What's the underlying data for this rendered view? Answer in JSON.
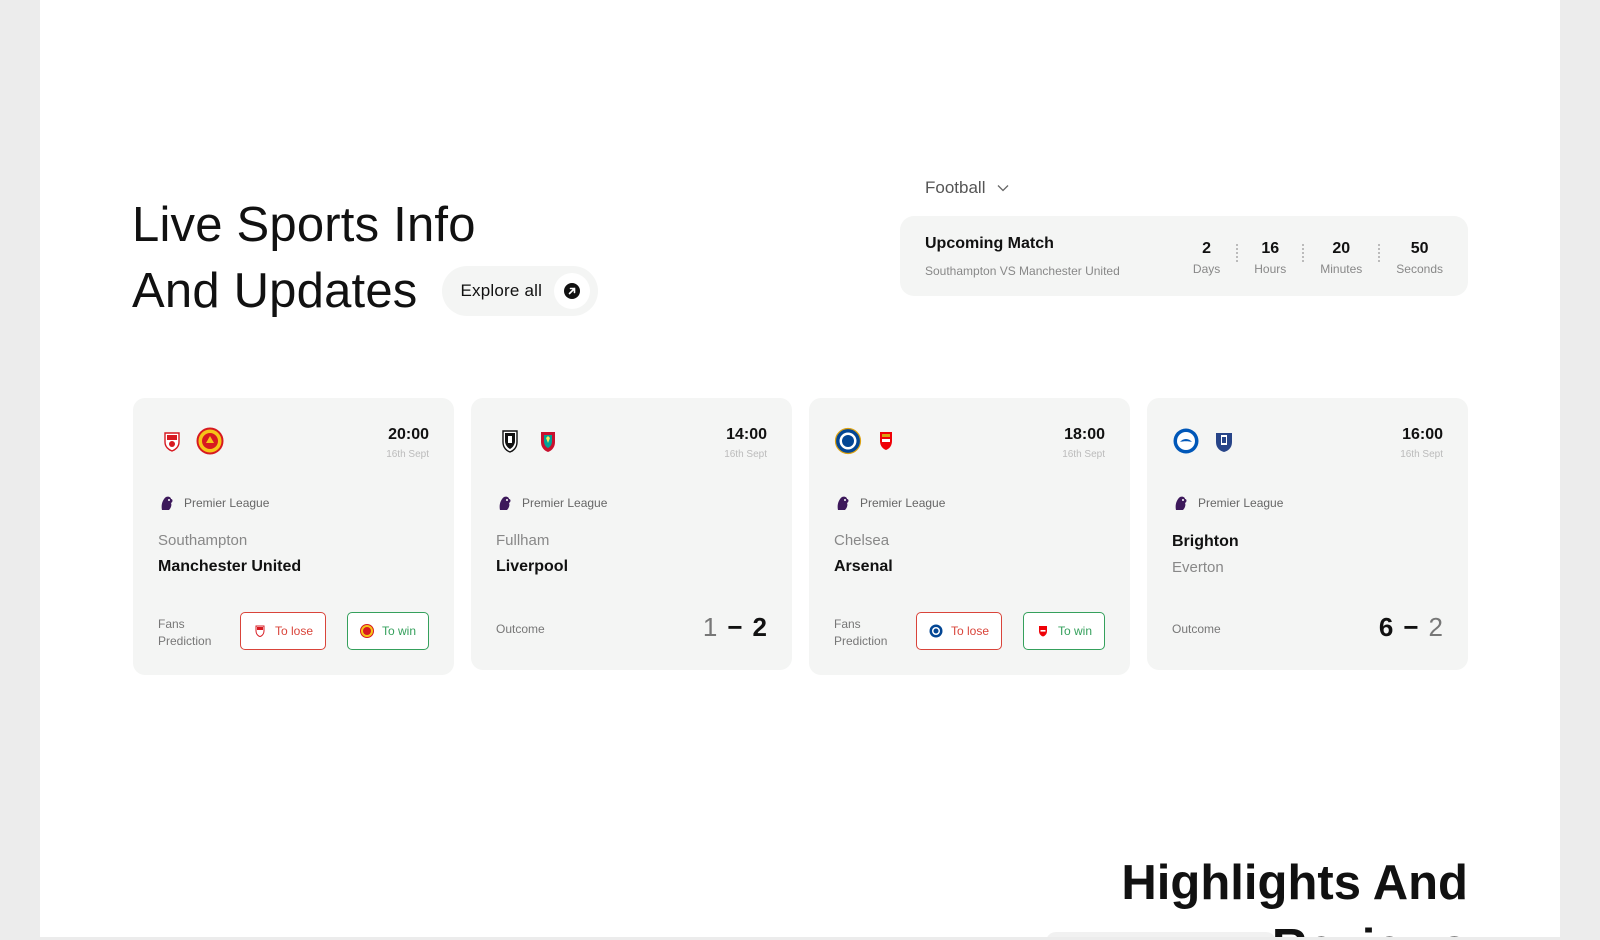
{
  "hero": {
    "title_line1": "Live Sports Info",
    "title_line2": "And Updates",
    "explore_label": "Explore all"
  },
  "sport_filter": {
    "selected": "Football"
  },
  "upcoming": {
    "title": "Upcoming Match",
    "subtitle": "Southampton VS Manchester United",
    "countdown": [
      {
        "value": "2",
        "label": "Days"
      },
      {
        "value": "16",
        "label": "Hours"
      },
      {
        "value": "20",
        "label": "Minutes"
      },
      {
        "value": "50",
        "label": "Seconds"
      }
    ]
  },
  "matches": [
    {
      "time": "20:00",
      "date": "16th Sept",
      "league": "Premier League",
      "team_a": "Southampton",
      "team_b": "Manchester United",
      "fans_label_1": "Fans",
      "fans_label_2": "Prediction",
      "lose_label": "To lose",
      "win_label": "To win"
    },
    {
      "time": "14:00",
      "date": "16th Sept",
      "league": "Premier League",
      "team_a": "Fullham",
      "team_b": "Liverpool",
      "outcome_label": "Outcome",
      "score_a": "1",
      "score_b": "2"
    },
    {
      "time": "18:00",
      "date": "16th Sept",
      "league": "Premier League",
      "team_a": "Chelsea",
      "team_b": "Arsenal",
      "fans_label_1": "Fans",
      "fans_label_2": "Prediction",
      "lose_label": "To lose",
      "win_label": "To win"
    },
    {
      "time": "16:00",
      "date": "16th Sept",
      "league": "Premier League",
      "team_a": "Brighton",
      "team_b": "Everton",
      "outcome_label": "Outcome",
      "score_a": "6",
      "score_b": "2"
    }
  ],
  "highlights": {
    "title_line1": "Highlights And",
    "title_line2": "Reviews"
  },
  "colors": {
    "lose": "#d9443a",
    "win": "#35a05c",
    "card_bg": "#f4f5f4"
  },
  "icons": {
    "explore": "arrow-up-right-icon",
    "dropdown": "chevron-down-icon",
    "league": "premier-league-lion-icon"
  }
}
